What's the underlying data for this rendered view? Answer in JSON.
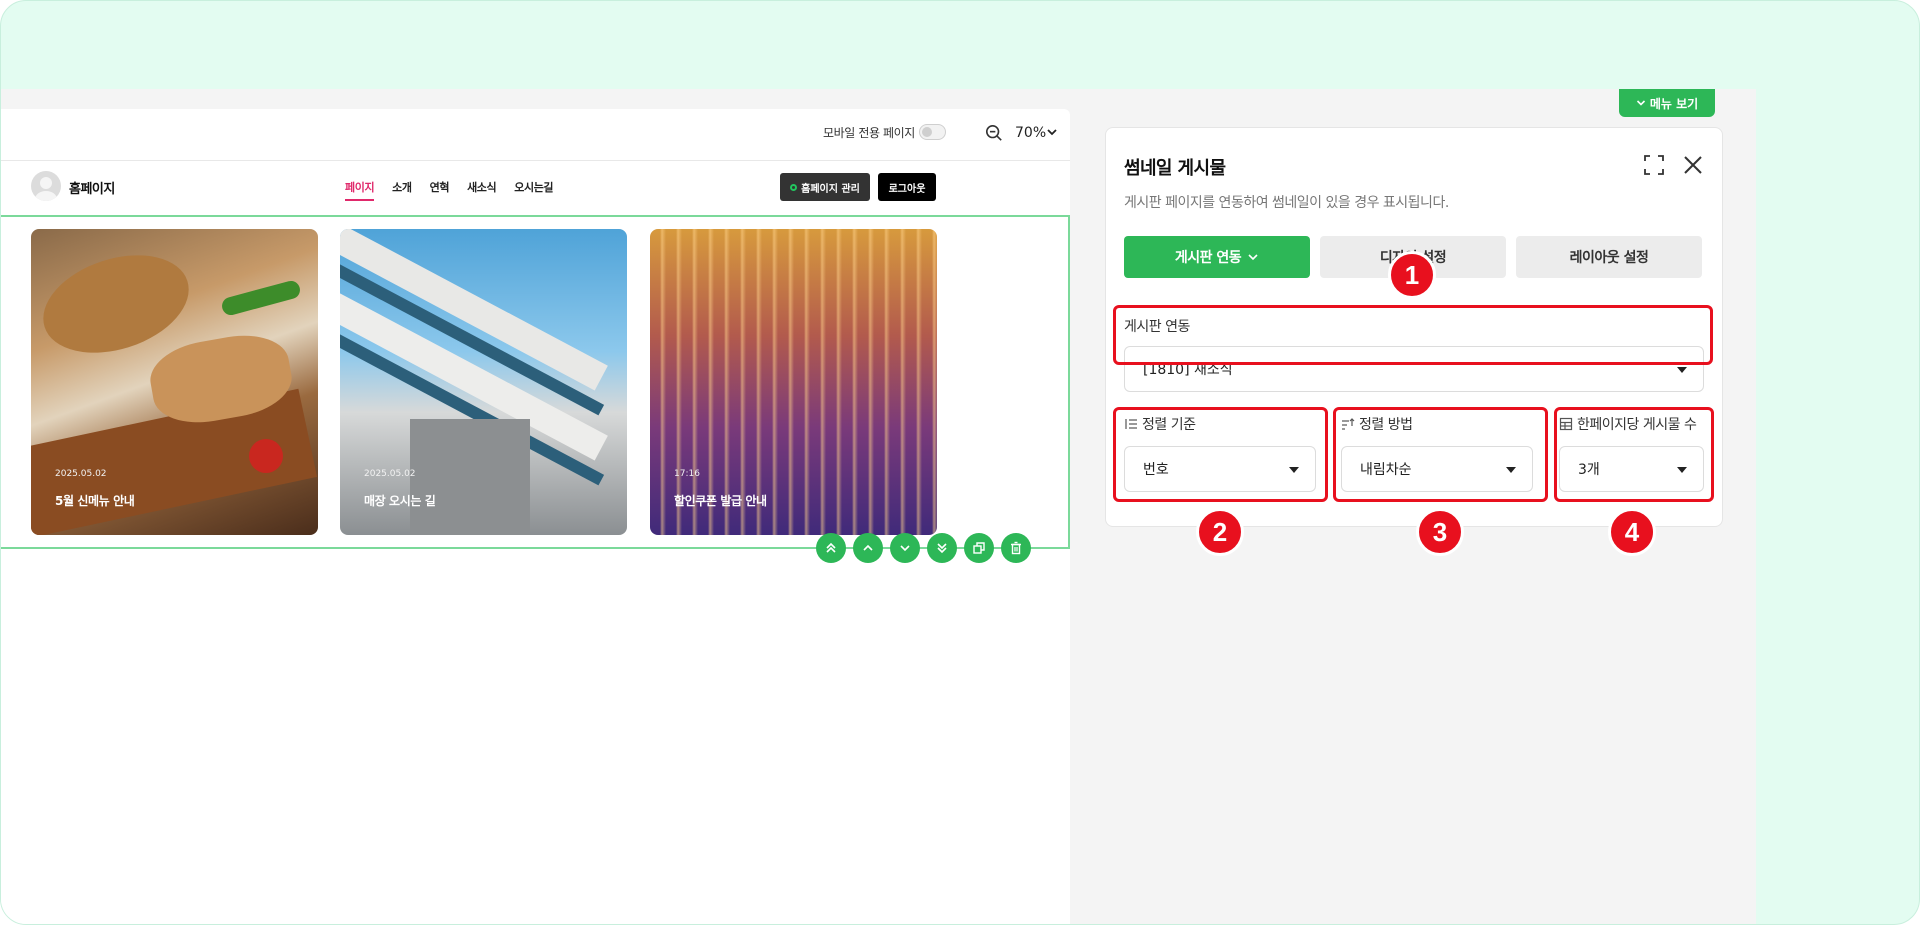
{
  "toolbar": {
    "mobile_page_label": "모바일 전용 페이지",
    "zoom_value": "70%"
  },
  "site": {
    "name": "홈페이지",
    "nav": [
      "페이지",
      "소개",
      "연혁",
      "새소식",
      "오시는길"
    ],
    "manage_button": "홈페이지 관리",
    "logout_button": "로그아웃"
  },
  "cards": [
    {
      "date": "2025.05.02",
      "title": "5월 신메뉴 안내"
    },
    {
      "date": "2025.05.02",
      "title": "매장 오시는 길"
    },
    {
      "date": "17:16",
      "title": "할인쿠폰 발급 안내"
    }
  ],
  "panel": {
    "menu_view": "메뉴 보기",
    "title": "썸네일 게시물",
    "description": "게시판 페이지를 연동하여 썸네일이 있을 경우 표시됩니다.",
    "tabs": [
      "게시판 연동",
      "디자인 설정",
      "레이아웃 설정"
    ],
    "board_link_label": "게시판 연동",
    "board_link_value": "[1810] 새소식",
    "sort_by_label": "정렬 기준",
    "sort_by_value": "번호",
    "sort_order_label": "정렬 방법",
    "sort_order_value": "내림차순",
    "per_page_label": "한페이지당 게시물 수",
    "per_page_value": "3개"
  },
  "annotations": [
    "1",
    "2",
    "3",
    "4"
  ],
  "colors": {
    "accent_green": "#2db757",
    "highlight_red": "#e8101e",
    "nav_active": "#e0296b",
    "background_mint": "#e3fcf1"
  }
}
